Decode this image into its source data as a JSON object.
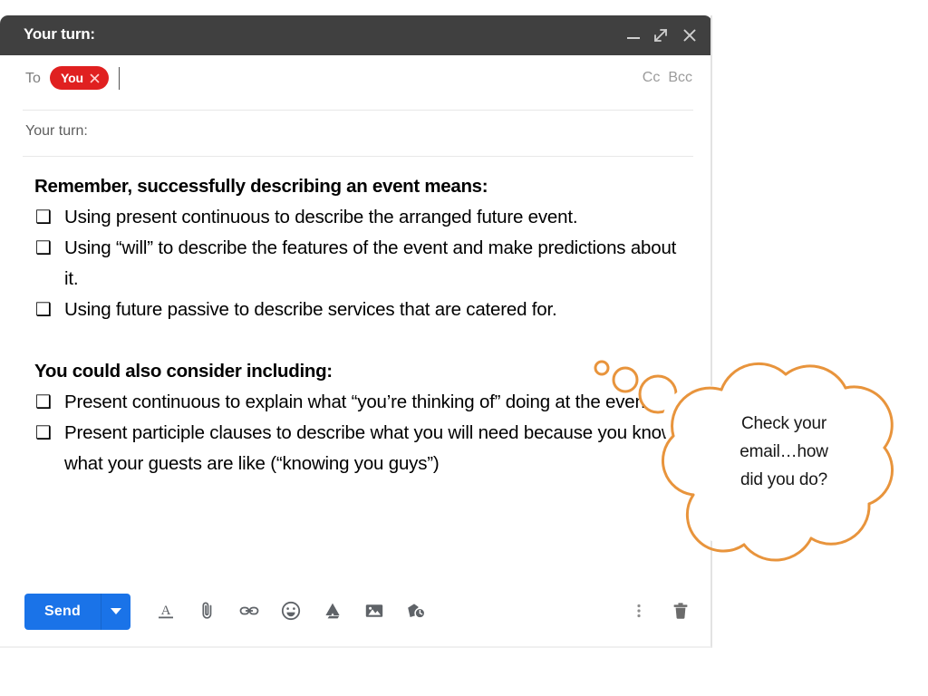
{
  "compose": {
    "title": "Your turn:",
    "window_controls": [
      {
        "name": "minimize",
        "icon": "minimize-icon"
      },
      {
        "name": "expand",
        "icon": "expand-icon"
      },
      {
        "name": "close",
        "icon": "close-icon"
      }
    ],
    "to": {
      "label": "To",
      "chip_label": "You",
      "chip_remove_icon": "close-icon",
      "cc_label": "Cc",
      "bcc_label": "Bcc"
    },
    "subject": {
      "value": "Your turn:"
    },
    "body": {
      "heading_1": "Remember, successfully describing an event means:",
      "bullets_1": [
        "Using present continuous to describe the arranged future event.",
        "Using “will” to describe the features of the event and make predictions about it.",
        "Using future passive to describe services that are catered for."
      ],
      "heading_2": "You could also consider including:",
      "bullets_2": [
        "Present continuous to  explain what “you’re thinking of” doing at the event.",
        "Present participle clauses to describe what you will need because you know what your guests are like (“knowing you guys”)"
      ],
      "bullet_marker": "❑"
    },
    "toolbar": {
      "send_label": "Send",
      "send_dropdown_icon": "chevron-down-icon",
      "icons": [
        "format-text-icon",
        "attach-file-icon",
        "insert-link-icon",
        "insert-emoji-icon",
        "google-drive-icon",
        "insert-photo-icon",
        "confidential-mode-icon"
      ],
      "more_options_icon": "more-options-icon",
      "discard_icon": "trash-icon"
    }
  },
  "annotation": {
    "bubble_text_lines": [
      "Check your",
      "email…how",
      "did you do?"
    ],
    "bubble_color": "#E8943C"
  },
  "colors": {
    "header_bg": "#404040",
    "chip_red": "#E02020",
    "send_blue": "#1A73E8",
    "bubble_orange": "#E8943C",
    "window_border": "#E3E3E3"
  }
}
